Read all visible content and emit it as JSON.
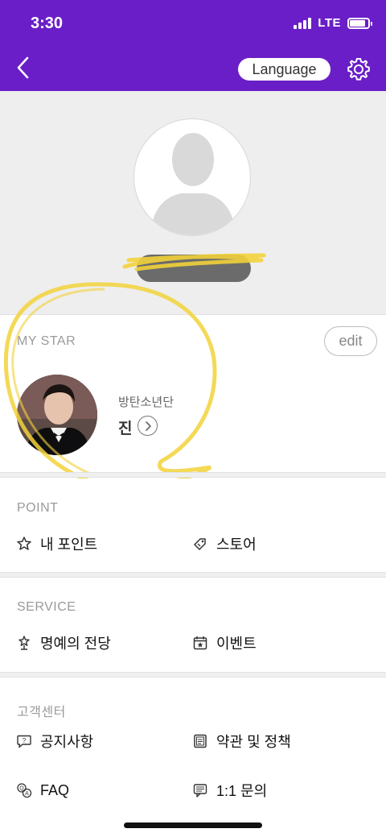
{
  "status_bar": {
    "time": "3:30",
    "network": "LTE",
    "battery_percent": 85
  },
  "header": {
    "language_label": "Language"
  },
  "my_star": {
    "title": "MY STAR",
    "edit_label": "edit",
    "group": "방탄소년단",
    "name": "진"
  },
  "point": {
    "title": "POINT",
    "items": [
      {
        "label": "내 포인트",
        "icon": "star-outline-icon"
      },
      {
        "label": "스토어",
        "icon": "store-tag-icon"
      }
    ]
  },
  "service": {
    "title": "SERVICE",
    "items": [
      {
        "label": "명예의 전당",
        "icon": "trophy-star-icon"
      },
      {
        "label": "이벤트",
        "icon": "calendar-star-icon"
      }
    ]
  },
  "support": {
    "title": "고객센터",
    "items": [
      {
        "label": "공지사항",
        "icon": "speech-question-icon"
      },
      {
        "label": "약관 및 정책",
        "icon": "document-icon"
      },
      {
        "label": "FAQ",
        "icon": "qa-icon"
      },
      {
        "label": "1:1 문의",
        "icon": "chat-doc-icon"
      }
    ]
  },
  "colors": {
    "header_bg": "#6a1ec7",
    "highlight": "#f2d23a"
  }
}
